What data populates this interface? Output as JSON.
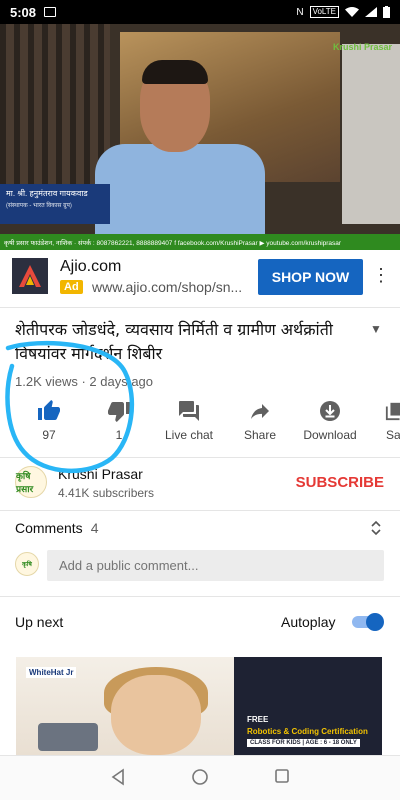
{
  "status_bar": {
    "time": "5:08",
    "network": "VoLTE"
  },
  "video": {
    "channel_mark": "Krushi Prasar",
    "nameplate_name": "मा. श्री. हनुमंतराव गायकवाड",
    "nameplate_sub": "(संस्थापक - भारत विकास ग्रुप)",
    "ticker": "कृषी प्रसार फाउंडेशन, नाशिक · संपर्क : 8087862221, 8888889407   f facebook.com/KrushiPrasar   ▶ youtube.com/krushiprasar"
  },
  "ad": {
    "title": "Ajio.com",
    "badge": "Ad",
    "url": "www.ajio.com/shop/sn...",
    "cta": "SHOP NOW",
    "logo_icon": "ajio-logo"
  },
  "video_info": {
    "title": "शेतीपरक जोडधंदे, व्यवसाय निर्मिती व ग्रामीण अर्थक्रांती विषयांवर मार्गदर्शन शिबीर",
    "meta": "1.2K views · 2 days ago"
  },
  "actions": [
    {
      "label": "97",
      "icon": "thumbs-up-icon"
    },
    {
      "label": "1",
      "icon": "thumbs-down-icon"
    },
    {
      "label": "Live chat",
      "icon": "live-chat-icon"
    },
    {
      "label": "Share",
      "icon": "share-icon"
    },
    {
      "label": "Download",
      "icon": "download-icon"
    },
    {
      "label": "Sa",
      "icon": "save-icon"
    }
  ],
  "channel": {
    "avatar_text": "कृषि प्रसार",
    "name": "Krushi Prasar",
    "subscribers": "4.41K subscribers",
    "subscribe_label": "SUBSCRIBE"
  },
  "comments": {
    "heading": "Comments",
    "count": "4",
    "placeholder": "Add a public comment..."
  },
  "up_next": {
    "label": "Up next",
    "autoplay_label": "Autoplay",
    "autoplay_on": true
  },
  "thumbnails": {
    "first_brand": "WhiteHat Jr",
    "second_free": "FREE",
    "second_course": "Robotics & Coding Certification",
    "second_tag": "CLASS FOR KIDS | AGE : 6 - 18 ONLY"
  },
  "colors": {
    "accent_blue": "#1565c0",
    "subscribe_red": "#e53935",
    "annotation_cyan": "#29b6f6"
  }
}
